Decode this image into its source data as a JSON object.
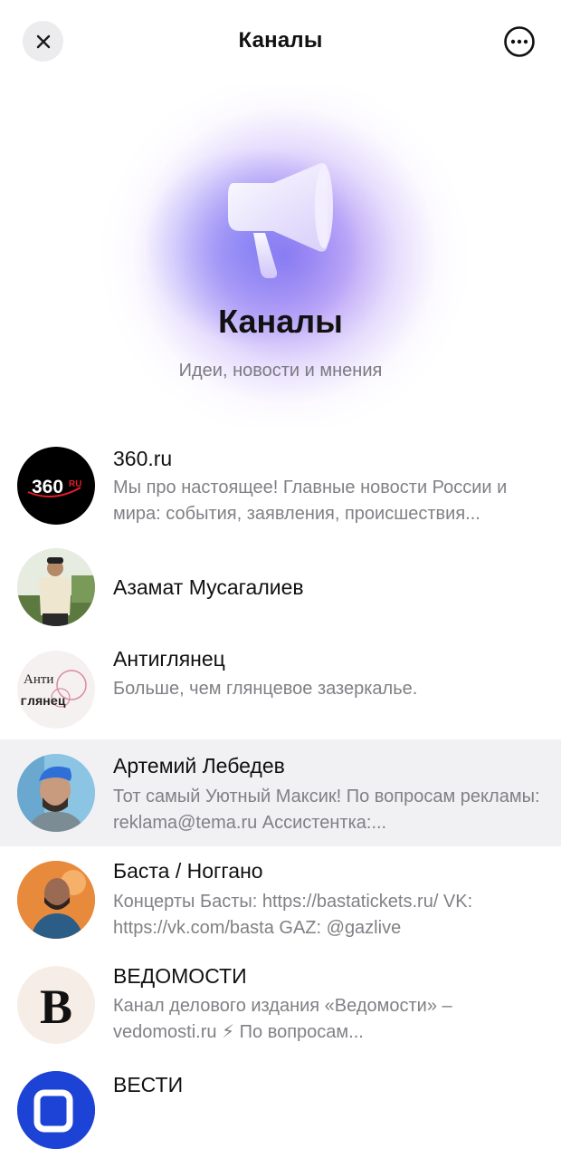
{
  "header": {
    "title": "Каналы",
    "close_icon": "close-icon",
    "more_icon": "more-icon"
  },
  "hero": {
    "icon": "megaphone-icon",
    "title": "Каналы",
    "subtitle": "Идеи, новости и мнения"
  },
  "channels": [
    {
      "name": "360.ru",
      "description": "Мы про настоящее! Главные новости России и мира: события, заявления, происшествия...",
      "avatar": "360-logo"
    },
    {
      "name": "Азамат Мусагалиев",
      "description": "",
      "avatar": "person-photo"
    },
    {
      "name": "Антиглянец",
      "description": "Больше, чем глянцевое зазеркалье.",
      "avatar": "antiglyanets-logo",
      "avatar_text_1": "Анти",
      "avatar_text_2": "глянец"
    },
    {
      "name": "Артемий Лебедев",
      "description": "Тот самый Уютный Максик! По вопросам рекламы: reklama@tema.ru Ассистентка:...",
      "avatar": "person-photo",
      "highlighted": true
    },
    {
      "name": "Баста / Ноггано",
      "description": "Концерты Басты: https://bastatickets.ru/ VK: https://vk.com/basta GAZ: @gazlive",
      "avatar": "person-photo"
    },
    {
      "name": "ВЕДОМОСТИ",
      "description": "Канал делового издания «Ведомости» – vedomosti.ru ⚡ По вопросам...",
      "avatar": "vedomosti-logo",
      "avatar_text": "B"
    },
    {
      "name": "ВЕСТИ",
      "description": "",
      "avatar": "vesti-logo"
    }
  ],
  "colors": {
    "accent_glow": "#9b7cf0",
    "secondary_text": "#808086",
    "row_highlight": "#f1f1f3"
  }
}
